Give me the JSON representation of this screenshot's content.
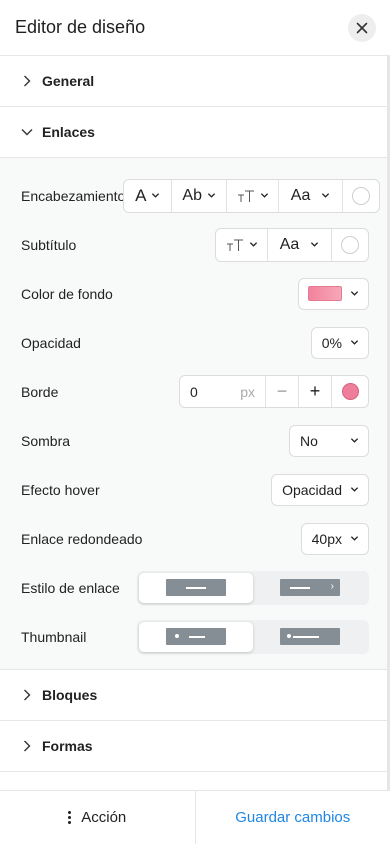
{
  "header": {
    "title": "Editor de diseño",
    "close_icon": "close-icon"
  },
  "sections": {
    "general": {
      "label": "General",
      "expanded": false
    },
    "enlaces": {
      "label": "Enlaces",
      "expanded": true
    },
    "bloques": {
      "label": "Bloques",
      "expanded": false
    },
    "formas": {
      "label": "Formas",
      "expanded": false
    }
  },
  "enlaces": {
    "encabezamiento": {
      "label": "Encabezamiento",
      "font_icon": "A",
      "weight_icon": "Ab",
      "size_icon": "ᴛT",
      "case_icon": "Aa",
      "color": "#ffffff"
    },
    "subtitulo": {
      "label": "Subtítulo",
      "size_icon": "ᴛT",
      "case_icon": "Aa",
      "color": "#ffffff"
    },
    "color_fondo": {
      "label": "Color de fondo",
      "color": "#f4909f"
    },
    "opacidad": {
      "label": "Opacidad",
      "value": "0%"
    },
    "borde": {
      "label": "Borde",
      "value": "0",
      "unit": "px",
      "minus": "−",
      "plus": "+",
      "color": "#ee7e9b"
    },
    "sombra": {
      "label": "Sombra",
      "value": "No"
    },
    "efecto_hover": {
      "label": "Efecto hover",
      "value": "Opacidad"
    },
    "enlace_redondeado": {
      "label": "Enlace redondeado",
      "value": "40px"
    },
    "estilo_enlace": {
      "label": "Estilo de enlace",
      "options": [
        "line",
        "line-arrow"
      ],
      "selected": 0
    },
    "thumbnail": {
      "label": "Thumbnail",
      "options": [
        "dot-line",
        "dot-line-compact"
      ],
      "selected": 0
    }
  },
  "footer": {
    "action_label": "Acción",
    "save_label": "Guardar cambios"
  },
  "colors": {
    "accent": "#1f86e5",
    "swatch_pink": "#f4909f",
    "border_pink": "#ee7e9b",
    "preview_bar": "#858d95"
  }
}
